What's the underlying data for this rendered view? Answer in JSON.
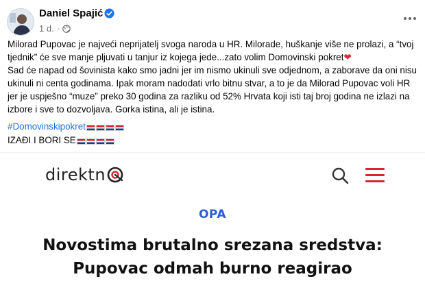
{
  "post": {
    "author": "Daniel Spajić",
    "time": "1 d.",
    "separator": "·",
    "text_main": "Milorad Pupovac je najveći neprijatelj svoga naroda u HR. Milorade, huškanje više ne prolazi, a “tvoj tjednik” će sve manje pljuvati u tanjur iz kojega jede...zato volim Domovinski pokret",
    "heart": "❤",
    "text_second": "Sad će napad od šovinista kako smo jadni jer im nismo ukinuli sve odjednom, a zaborave da oni nisu ukinuli ni centa godinama. Ipak moram nadodati vrlo bitnu stvar, a to je da Milorad Pupovac voli HR jer je uspješno “muze” preko 30 godina za razliku od 52% Hrvata koji isti taj broj godina ne izlazi na izbore i sve to dozvoljava. Gorka istina, ali je istina.",
    "hashtag": "#Domovinskipokret",
    "closing": "IZAĐI I BORI SE"
  },
  "article": {
    "site_name": "direktn",
    "category": "OPA",
    "headline_line1": "Novostima brutalno srezana sredstva:",
    "headline_line2": "Pupovac odmah burno reagirao"
  },
  "colors": {
    "link": "#216fdb",
    "accent": "#d7252c",
    "category": "#2d5bd8",
    "verified": "#1877f2"
  },
  "icons": {
    "verified": "verified-badge-icon",
    "globe": "globe-icon",
    "more": "more-options-icon",
    "search": "search-icon",
    "menu": "hamburger-menu-icon",
    "flag": "croatian-flag-icon"
  }
}
